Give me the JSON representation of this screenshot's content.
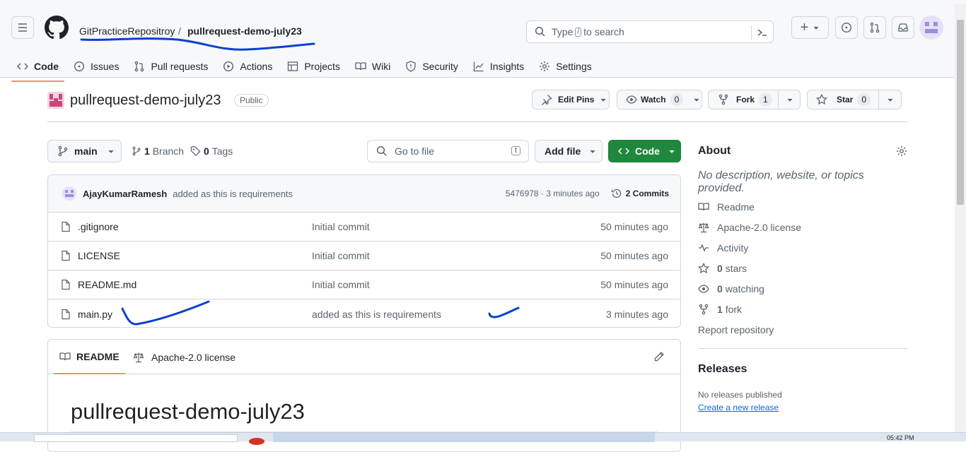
{
  "header": {
    "owner": "GitPracticeRepositroy",
    "separator": "/",
    "repo": "pullrequest-demo-july23",
    "search_prefix": "Type",
    "search_key": "/",
    "search_suffix": "to search",
    "plus_label": "+"
  },
  "tabs": [
    {
      "label": "Code",
      "icon": "code-icon"
    },
    {
      "label": "Issues",
      "icon": "issue-icon"
    },
    {
      "label": "Pull requests",
      "icon": "pull-request-icon"
    },
    {
      "label": "Actions",
      "icon": "play-icon"
    },
    {
      "label": "Projects",
      "icon": "table-icon"
    },
    {
      "label": "Wiki",
      "icon": "book-icon"
    },
    {
      "label": "Security",
      "icon": "shield-icon"
    },
    {
      "label": "Insights",
      "icon": "graph-icon"
    },
    {
      "label": "Settings",
      "icon": "gear-icon"
    }
  ],
  "repo": {
    "name": "pullrequest-demo-july23",
    "visibility": "Public",
    "edit_pins": "Edit Pins",
    "watch_label": "Watch",
    "watch_count": "0",
    "fork_label": "Fork",
    "fork_count": "1",
    "star_label": "Star",
    "star_count": "0"
  },
  "toolbar": {
    "branch": "main",
    "branch_count": "1",
    "branch_label": "Branch",
    "tag_count": "0",
    "tag_label": "Tags",
    "goto_placeholder": "Go to file",
    "goto_key": "t",
    "add_file": "Add file",
    "code": "Code"
  },
  "commit": {
    "author": "AjayKumarRamesh",
    "message": "added as this is requirements",
    "hash_time": "5476978 · 3 minutes ago",
    "commits": "2 Commits"
  },
  "files": [
    {
      "name": ".gitignore",
      "message": "Initial commit",
      "time": "50 minutes ago"
    },
    {
      "name": "LICENSE",
      "message": "Initial commit",
      "time": "50 minutes ago"
    },
    {
      "name": "README.md",
      "message": "Initial commit",
      "time": "50 minutes ago"
    },
    {
      "name": "main.py",
      "message": "added as this is requirements",
      "time": "3 minutes ago"
    }
  ],
  "readme": {
    "tab_readme": "README",
    "tab_license": "Apache-2.0 license",
    "heading": "pullrequest-demo-july23"
  },
  "about": {
    "title": "About",
    "description": "No description, website, or topics provided.",
    "readme": "Readme",
    "license": "Apache-2.0 license",
    "activity": "Activity",
    "stars_count": "0",
    "stars": "stars",
    "watching_count": "0",
    "watching": "watching",
    "fork_count": "1",
    "fork": "fork",
    "report": "Report repository",
    "releases_title": "Releases",
    "releases_none": "No releases published",
    "create_release": "Create a new release"
  },
  "taskbar": {
    "time": "05:42 PM"
  },
  "colors": {
    "accent_green": "#1f883d",
    "annotation_blue": "#0b3fd1",
    "link": "#0969da",
    "tab_underline": "#fd8c73"
  }
}
